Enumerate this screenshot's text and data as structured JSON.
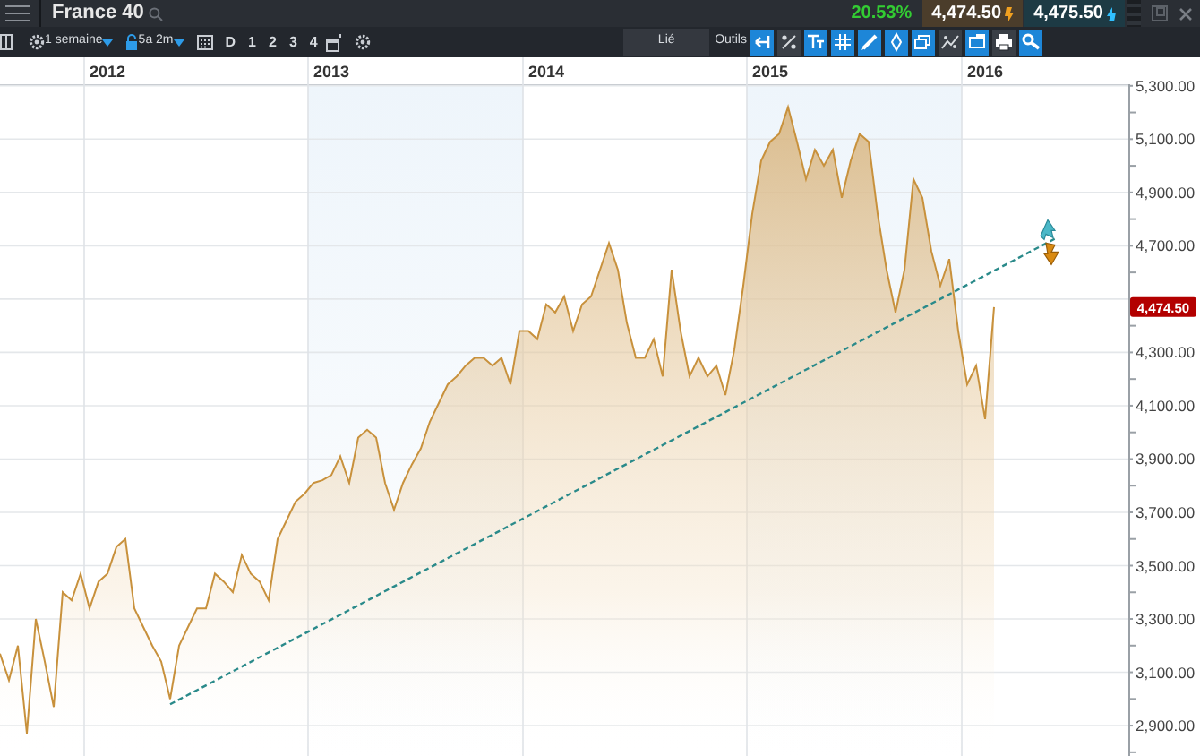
{
  "top_bar": {
    "title": "France 40",
    "change": "20.53%",
    "sell": "4,474.50",
    "buy": "4,475.50"
  },
  "toolbar": {
    "period": "1 semaine",
    "range": "5a 2m",
    "quick_ranges": [
      "D",
      "1",
      "2",
      "3",
      "4"
    ],
    "link": "Lié",
    "tools_label": "Outils",
    "tools": [
      {
        "selected": true
      },
      {
        "selected": false
      },
      {
        "selected": true
      },
      {
        "selected": true
      },
      {
        "selected": true
      },
      {
        "selected": true
      },
      {
        "selected": true
      },
      {
        "selected": false
      },
      {
        "selected": true
      },
      {
        "selected": false
      },
      {
        "selected": true
      }
    ]
  },
  "chart": {
    "chart_data": {
      "type": "area",
      "grid": true,
      "categories": [
        null,
        null,
        null,
        null,
        null,
        null,
        null,
        null,
        null,
        null,
        null,
        null,
        "2012",
        null,
        null,
        null,
        null,
        null,
        null,
        null,
        null,
        null,
        null,
        null,
        null,
        null,
        null,
        null,
        null,
        null,
        null,
        null,
        null,
        null,
        null,
        null,
        null,
        "2013",
        null,
        null,
        null,
        null,
        null,
        null,
        null,
        null,
        null,
        null,
        null,
        null,
        null,
        null,
        null,
        null,
        null,
        null,
        null,
        null,
        null,
        null,
        null,
        "2014",
        null,
        null,
        null,
        null,
        null,
        null,
        null,
        null,
        null,
        null,
        null,
        null,
        null,
        null,
        null,
        null,
        null,
        null,
        null,
        null,
        null,
        null,
        null,
        null,
        "2015",
        null,
        null,
        null,
        null,
        null,
        null,
        null,
        null,
        null,
        null,
        null,
        null,
        null,
        null,
        null,
        null,
        null,
        null,
        null,
        null,
        null,
        null,
        null,
        "2016",
        null,
        null,
        null,
        null,
        null,
        null,
        null,
        null,
        null,
        null,
        null,
        null,
        null,
        null,
        null
      ],
      "series": [
        {
          "color": "#c8913c",
          "values": [
            3170,
            3070,
            3200,
            2870,
            3300,
            3140,
            2970,
            3400,
            3370,
            3470,
            3340,
            3440,
            3470,
            3570,
            3600,
            3340,
            3270,
            3200,
            3140,
            3000,
            3200,
            3270,
            3340,
            3340,
            3470,
            3440,
            3400,
            3540,
            3470,
            3440,
            3370,
            3600,
            3670,
            3740,
            3770,
            3810,
            3820,
            3840,
            3910,
            3810,
            3980,
            4010,
            3980,
            3810,
            3710,
            3810,
            3880,
            3940,
            4040,
            4110,
            4180,
            4210,
            4250,
            4280,
            4280,
            4250,
            4280,
            4180,
            4380,
            4380,
            4350,
            4480,
            4450,
            4510,
            4380,
            4480,
            4510,
            4610,
            4710,
            4610,
            4410,
            4280,
            4280,
            4350,
            4210,
            4610,
            4380,
            4210,
            4280,
            4210,
            4250,
            4140,
            4310,
            4550,
            4820,
            5020,
            5090,
            5120,
            5220,
            5090,
            4950,
            5060,
            5000,
            5060,
            4880,
            5020,
            5120,
            5090,
            4820,
            4610,
            4450,
            4610,
            4950,
            4880,
            4680,
            4550,
            4650,
            4380,
            4180,
            4250,
            4050,
            4470,
            null,
            null,
            null,
            null,
            null,
            null,
            null,
            null,
            null,
            null,
            null,
            null,
            null,
            null
          ]
        },
        {
          "type": "line",
          "line_style": "dashed",
          "color": "#2a8a8a",
          "values": [
            null,
            null,
            null,
            null,
            null,
            null,
            null,
            null,
            null,
            null,
            null,
            null,
            null,
            null,
            null,
            null,
            null,
            null,
            null,
            2980,
            null,
            null,
            null,
            null,
            null,
            null,
            null,
            null,
            null,
            null,
            null,
            null,
            null,
            null,
            null,
            null,
            null,
            null,
            null,
            null,
            null,
            null,
            null,
            null,
            null,
            null,
            null,
            null,
            null,
            null,
            null,
            null,
            null,
            null,
            null,
            null,
            null,
            null,
            null,
            null,
            null,
            null,
            null,
            null,
            null,
            null,
            null,
            null,
            null,
            null,
            null,
            null,
            null,
            null,
            null,
            null,
            null,
            null,
            null,
            null,
            null,
            null,
            null,
            null,
            null,
            null,
            null,
            null,
            null,
            null,
            null,
            null,
            null,
            null,
            null,
            null,
            null,
            null,
            null,
            null,
            null,
            null,
            null,
            null,
            null,
            null,
            null,
            null,
            null,
            null,
            null,
            null,
            null,
            null,
            null,
            null,
            null,
            null,
            4730,
            null,
            null,
            null,
            null,
            null,
            null,
            null
          ]
        }
      ],
      "ylim": [
        2786,
        5306
      ],
      "yticks": [
        {
          "value": 2900,
          "label": "2,900.00"
        },
        {
          "value": 3100,
          "label": "3,100.00"
        },
        {
          "value": 3300,
          "label": "3,300.00"
        },
        {
          "value": 3500,
          "label": "3,500.00"
        },
        {
          "value": 3700,
          "label": "3,700.00"
        },
        {
          "value": 3900,
          "label": "3,900.00"
        },
        {
          "value": 4100,
          "label": "4,100.00"
        },
        {
          "value": 4300,
          "label": "4,300.00"
        },
        {
          "value": 4700,
          "label": "4,700.00"
        },
        {
          "value": 4900,
          "label": "4,900.00"
        },
        {
          "value": 5100,
          "label": "5,100.00"
        },
        {
          "value": 5300,
          "label": "5,300.00"
        }
      ],
      "annotations": [
        {
          "text": "4,474.50"
        }
      ]
    }
  }
}
